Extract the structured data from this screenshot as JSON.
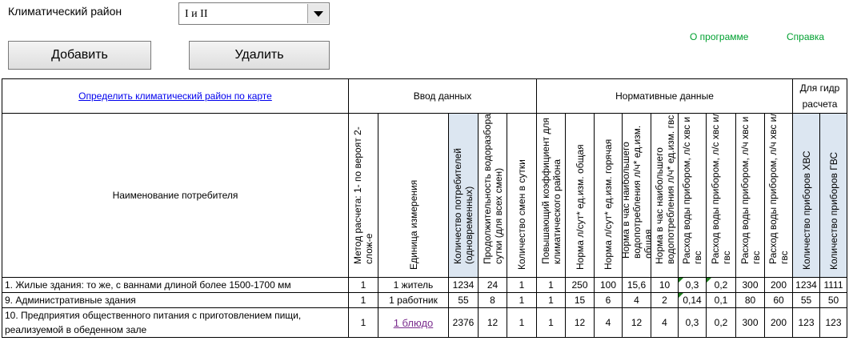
{
  "climate": {
    "label": "Климатический район",
    "selected": "I и II"
  },
  "links": {
    "about": "О программе",
    "help": "Справка"
  },
  "buttons": {
    "add": "Добавить",
    "delete": "Удалить"
  },
  "table": {
    "map_link": "Определить климатический район по карте",
    "group_input": "Ввод данных",
    "group_norm": "Нормативные данные",
    "group_hydro": "Для гидр расчета",
    "name_header": "Наименование потребителя",
    "columns": [
      "Метод расчета:   1- по вероят 2- слож-е",
      "Единица измерения",
      "Количество потребителей (одновременных)",
      "Продолжительность водоразбора в сутки (для всех смен)",
      "Количество смен в сутки",
      "Повышающий коэффициент для климатического района",
      "Норма л/сут* ед.изм. общая",
      "Норма л/сут* ед.изм. горячая",
      "Норма в час наибольшего водопотребления л/ч* ед.изм. общая",
      "Норма в час наибольшего водопотребления л/ч* ед.изм. гвс",
      "Расход воды прибором, л/с хвс и гвс",
      "Расход воды прибором, л/с хвс или гвс",
      "Расход воды прибором, л/ч хвс и гвс",
      "Расход воды прибором, л/ч хвс или гвс",
      "Количество приборов ХВС",
      "Количество приборов ГВС"
    ],
    "rows": [
      {
        "name": "1. Жилые здания: то же, с ваннами длиной более 1500-1700 мм",
        "cells": [
          "1",
          "1 житель",
          "1234",
          "24",
          "1",
          "1",
          "250",
          "100",
          "15,6",
          "10",
          "0,3",
          "0,2",
          "300",
          "200",
          "1234",
          "1111"
        ]
      },
      {
        "name": "9. Административные здания",
        "cells": [
          "1",
          "1 работник",
          "55",
          "8",
          "1",
          "1",
          "15",
          "6",
          "4",
          "2",
          "0,14",
          "0,1",
          "80",
          "60",
          "55",
          "50"
        ]
      },
      {
        "name": "10. Предприятия общественного питания с приготовлением пищи, реализуемой в обеденном зале",
        "cells": [
          "1",
          "1 блюдо",
          "2376",
          "12",
          "1",
          "1",
          "12",
          "4",
          "12",
          "4",
          "0,3",
          "0,2",
          "300",
          "200",
          "123",
          "123"
        ]
      }
    ]
  },
  "colors": {
    "link_green": "#00a030",
    "link_blue": "#0000ee",
    "header_blue_fill": "#dce6f1",
    "comment_marker": "#1e7d1e"
  }
}
